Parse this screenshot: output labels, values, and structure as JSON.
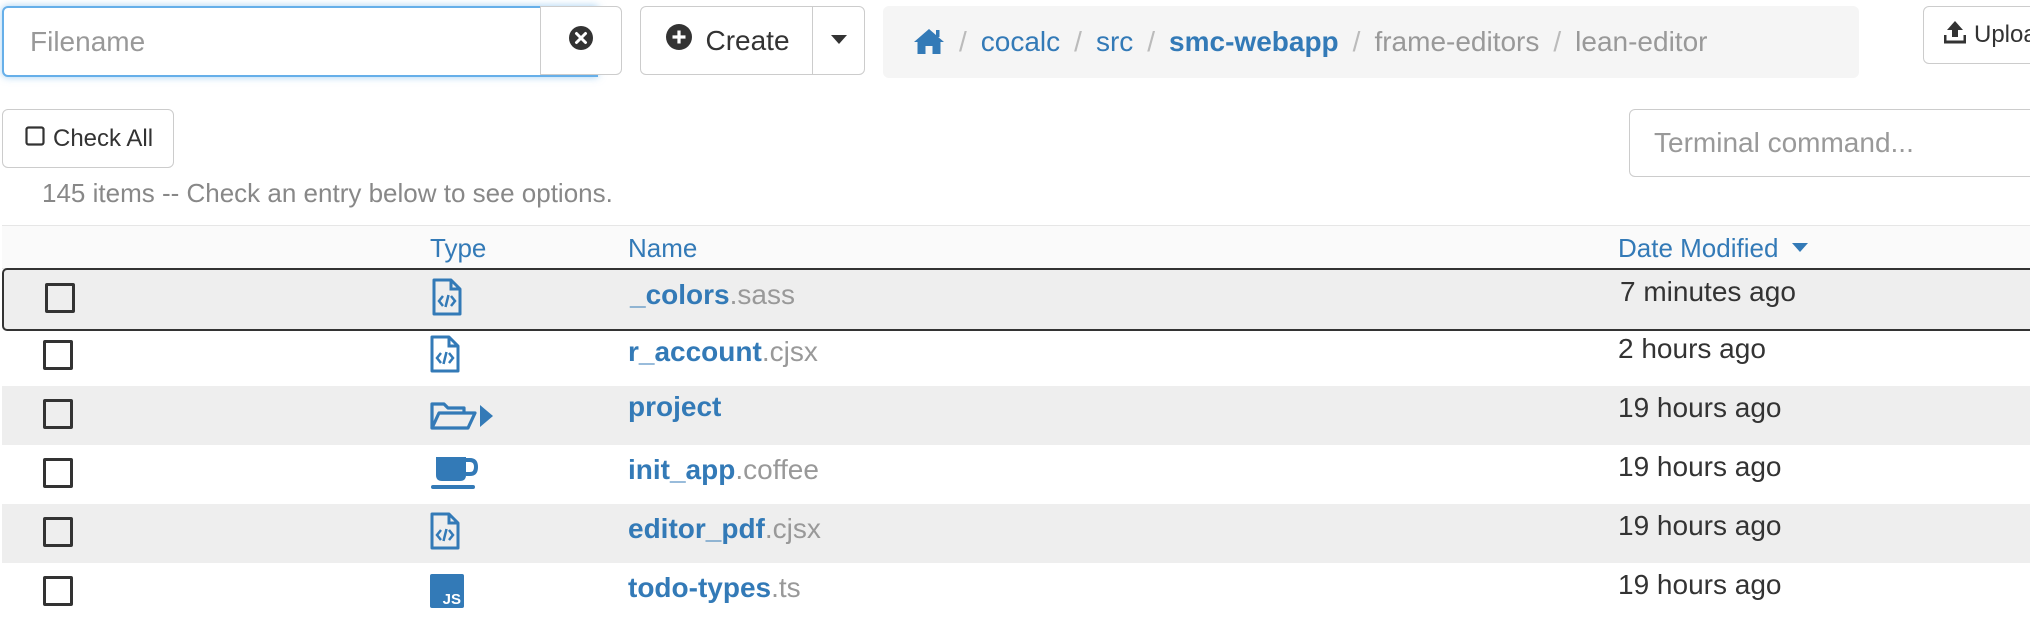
{
  "toolbar": {
    "search": {
      "value": "",
      "placeholder": "Filename"
    },
    "create_label": "Create",
    "upload_label": "Upload",
    "check_all_label": "Check All",
    "terminal": {
      "placeholder": "Terminal command..."
    }
  },
  "breadcrumb": {
    "home_icon": "home-icon",
    "items": [
      {
        "label": "cocalc"
      },
      {
        "label": "src"
      },
      {
        "label": "smc-webapp"
      },
      {
        "label": "frame-editors"
      },
      {
        "label": "lean-editor"
      }
    ]
  },
  "listing": {
    "summary": "145 items -- Check an entry below to see options.",
    "columns": {
      "type": "Type",
      "name": "Name",
      "date": "Date Modified"
    },
    "sort": {
      "column": "Date Modified",
      "direction": "descending"
    },
    "rows": [
      {
        "base": "_colors",
        "ext": ".sass",
        "date": "7 minutes ago",
        "icon": "code-file-icon",
        "checked": false
      },
      {
        "base": "r_account",
        "ext": ".cjsx",
        "date": "2 hours ago",
        "icon": "code-file-icon",
        "checked": false
      },
      {
        "base": "project",
        "ext": "",
        "date": "19 hours ago",
        "icon": "open-folder-icon",
        "checked": false
      },
      {
        "base": "init_app",
        "ext": ".coffee",
        "date": "19 hours ago",
        "icon": "coffee-icon",
        "checked": false
      },
      {
        "base": "editor_pdf",
        "ext": ".cjsx",
        "date": "19 hours ago",
        "icon": "code-file-icon",
        "checked": false
      },
      {
        "base": "todo-types",
        "ext": ".ts",
        "date": "19 hours ago",
        "icon": "js-file-icon",
        "checked": false
      }
    ]
  },
  "colors": {
    "link": "#337ab7",
    "muted": "#999999",
    "stripe": "#eeeeee",
    "focus": "#66afe9"
  }
}
